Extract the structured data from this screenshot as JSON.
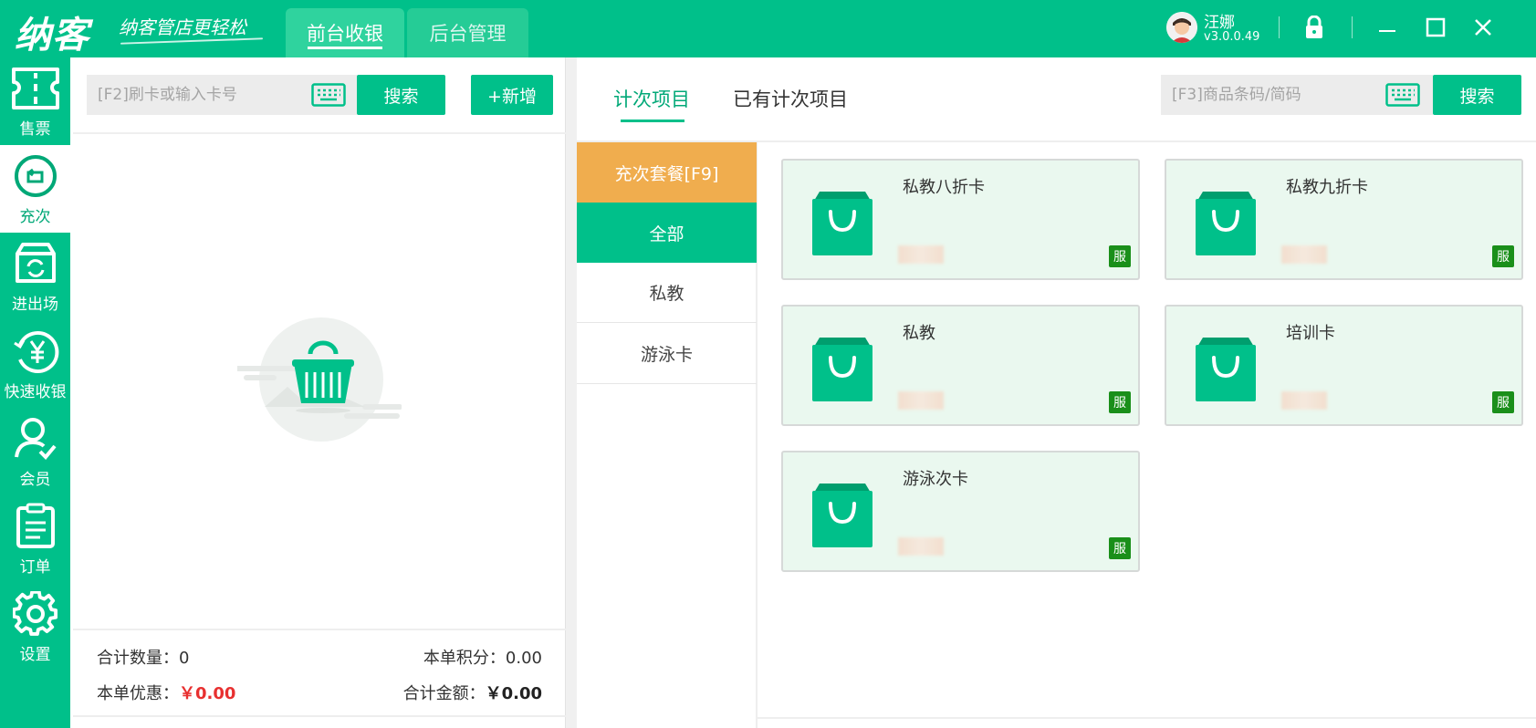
{
  "header": {
    "logo": "纳客",
    "slogan": "纳客管店更轻松",
    "tabs": [
      {
        "label": "前台收银",
        "active": true
      },
      {
        "label": "后台管理",
        "active": false
      }
    ],
    "user": {
      "name": "汪娜",
      "version": "v3.0.0.49"
    },
    "icons": [
      "lock-icon",
      "minimize-icon",
      "maximize-icon",
      "close-icon"
    ]
  },
  "nav": {
    "items": [
      {
        "label": "售票",
        "icon": "ticket-icon"
      },
      {
        "label": "充次",
        "icon": "recharge-icon",
        "active": true
      },
      {
        "label": "进出场",
        "icon": "entry-exit-icon"
      },
      {
        "label": "快速收银",
        "icon": "quick-cash-icon"
      },
      {
        "label": "会员",
        "icon": "member-icon"
      },
      {
        "label": "订单",
        "icon": "order-icon"
      },
      {
        "label": "设置",
        "icon": "settings-icon"
      }
    ]
  },
  "left": {
    "card_placeholder": "[F2]刷卡或输入卡号",
    "search_label": "搜索",
    "add_label": "+新增",
    "summary": {
      "qty_label": "合计数量：",
      "qty_value": "0",
      "points_label": "本单积分：",
      "points_value": "0.00",
      "discount_label": "本单优惠：",
      "discount_value": "￥0.00",
      "total_label": "合计金额：",
      "total_value": "￥0.00"
    }
  },
  "right": {
    "tabs": [
      {
        "label": "计次项目",
        "active": true
      },
      {
        "label": "已有计次项目",
        "active": false
      }
    ],
    "product_placeholder": "[F3]商品条码/简码",
    "search_label": "搜索",
    "categories": [
      {
        "label": "充次套餐[F9]",
        "type": "package"
      },
      {
        "label": "全部",
        "selected": true
      },
      {
        "label": "私教"
      },
      {
        "label": "游泳卡"
      }
    ],
    "products": [
      {
        "name": "私教八折卡",
        "tag": "服"
      },
      {
        "name": "私教九折卡",
        "tag": "服"
      },
      {
        "name": "私教",
        "tag": "服"
      },
      {
        "name": "培训卡",
        "tag": "服"
      },
      {
        "name": "游泳次卡",
        "tag": "服"
      }
    ]
  },
  "colors": {
    "primary": "#00c08a",
    "package": "#f0ad4e",
    "card_bg": "#eaf8ef",
    "tag": "#1a8f1a",
    "amount_red": "#e83030"
  }
}
